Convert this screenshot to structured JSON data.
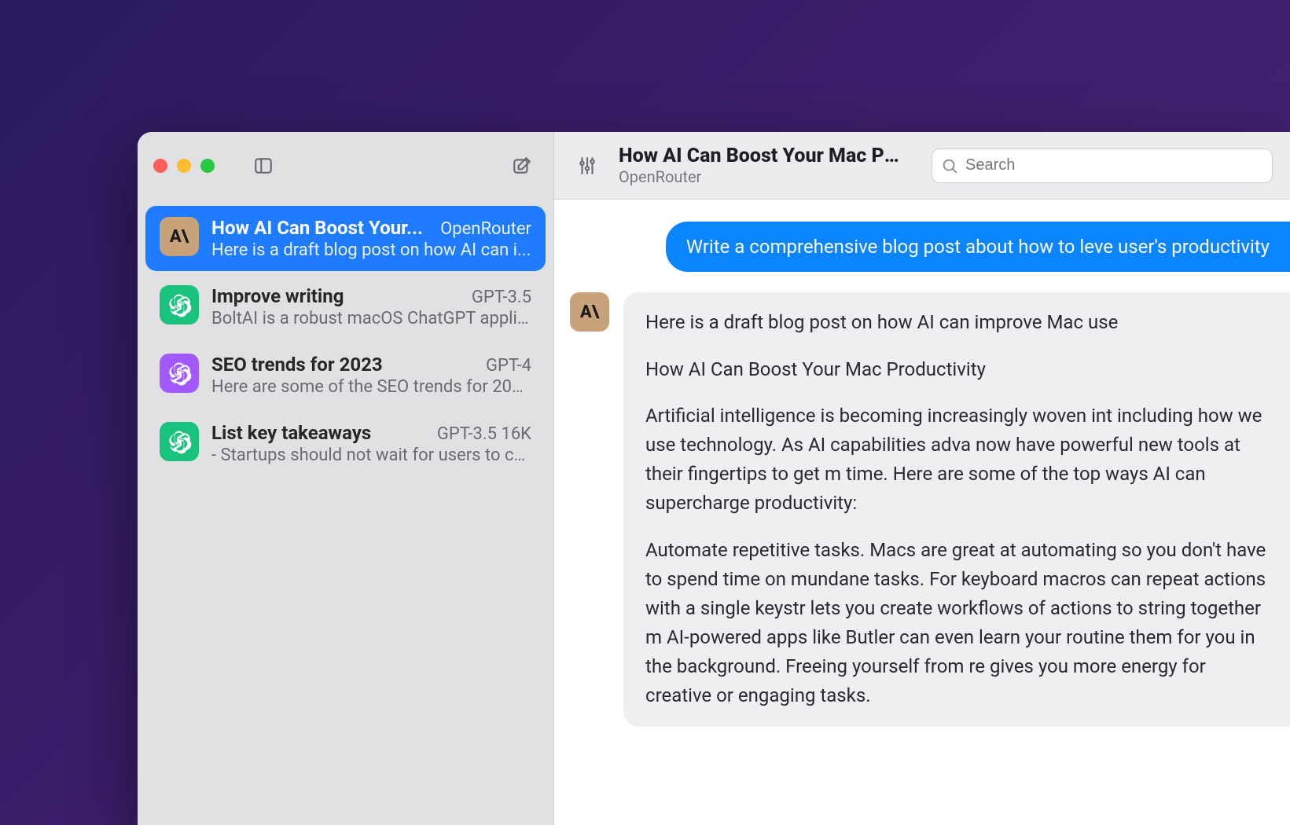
{
  "sidebar": {
    "conversations": [
      {
        "title": "How AI Can Boost Your...",
        "model": "OpenRouter",
        "preview": "Here is a draft blog post on how AI can i...",
        "icon": "anthropic",
        "selected": true
      },
      {
        "title": "Improve writing",
        "model": "GPT-3.5",
        "preview": "BoltAI is a robust macOS ChatGPT applic...",
        "icon": "openai-green",
        "selected": false
      },
      {
        "title": "SEO trends for 2023",
        "model": "GPT-4",
        "preview": "Here are some of the SEO trends for 202...",
        "icon": "openai-purple",
        "selected": false
      },
      {
        "title": "List key takeaways",
        "model": "GPT-3.5 16K",
        "preview": "- Startups should not wait for users to co...",
        "icon": "openai-green",
        "selected": false
      }
    ]
  },
  "header": {
    "title": "How AI Can Boost Your Mac Pr...",
    "subtitle": "OpenRouter",
    "search_placeholder": "Search"
  },
  "chat": {
    "user_message": "Write a comprehensive blog post about how to leve user's productivity",
    "assistant_avatar_text": "A\\",
    "assistant_paragraphs": [
      "Here is a draft blog post on how AI can improve Mac use",
      "How AI Can Boost Your Mac Productivity",
      "Artificial intelligence is becoming increasingly woven int including how we use technology. As AI capabilities adva now have powerful new tools at their fingertips to get m time. Here are some of the top ways AI can supercharge productivity:",
      "Automate repetitive tasks. Macs are great at automating so you don't have to spend time on mundane tasks. For keyboard macros can repeat actions with a single keystr lets you create workflows of actions to string together m AI-powered apps like Butler can even learn your routine them for you in the background. Freeing yourself from re gives you more energy for creative or engaging tasks."
    ]
  },
  "icons": {
    "anthropic_text": "A\\"
  }
}
